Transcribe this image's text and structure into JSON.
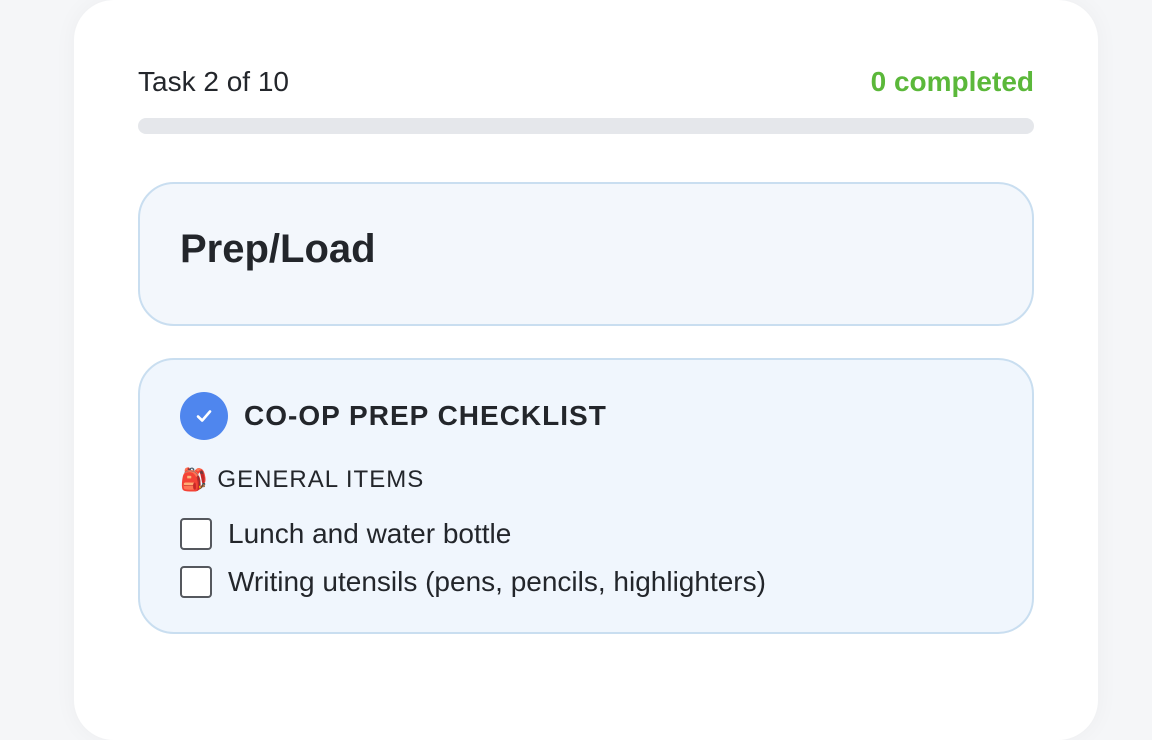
{
  "progress": {
    "task_counter": "Task 2 of 10",
    "completed": "0 completed",
    "completed_fraction": 0,
    "accent_color": "#5bb83a"
  },
  "task": {
    "title": "Prep/Load"
  },
  "checklist": {
    "badge_icon": "check-icon",
    "badge_color": "#4f86ee",
    "title": "CO-OP PREP CHECKLIST",
    "section": {
      "emoji": "🎒",
      "label": "GENERAL ITEMS"
    },
    "items": [
      {
        "label": "Lunch and water bottle",
        "checked": false
      },
      {
        "label": "Writing utensils (pens, pencils, highlighters)",
        "checked": false
      }
    ]
  }
}
